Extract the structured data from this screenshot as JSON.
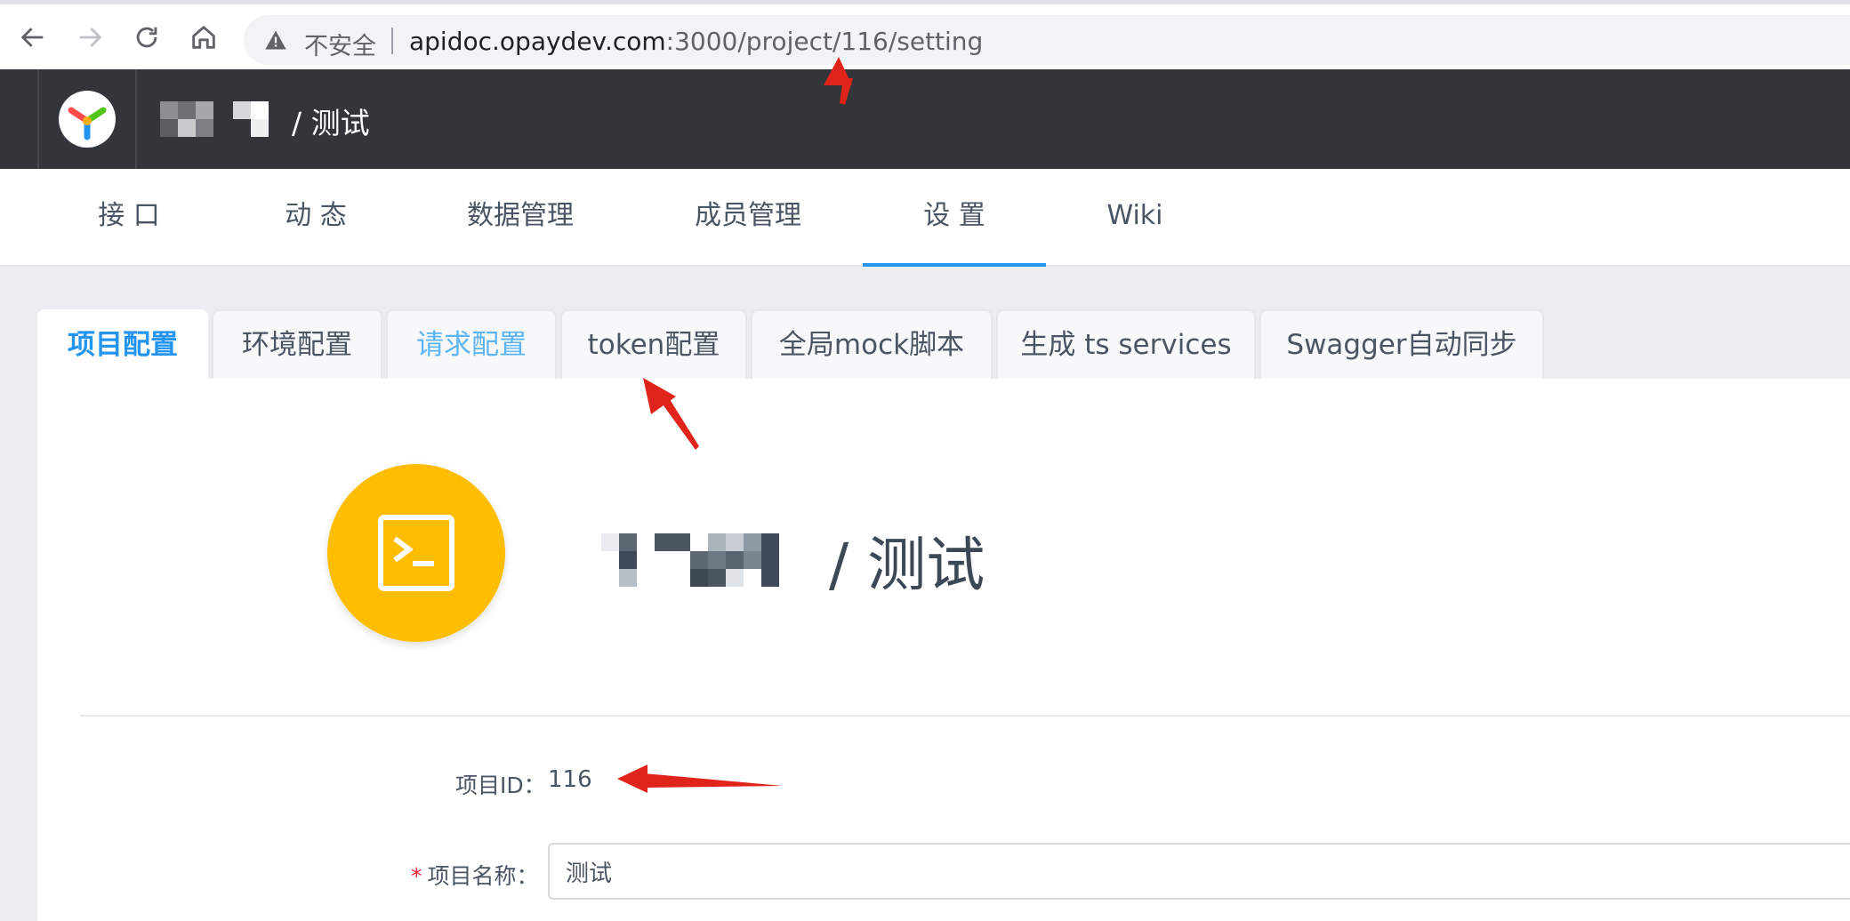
{
  "browser": {
    "url_insecure_label": "不安全",
    "url_host": "apidoc.opaydev.com",
    "url_path": ":3000/project/116/setting",
    "icons": [
      "back-arrow-icon",
      "forward-arrow-icon",
      "reload-icon",
      "home-icon",
      "warning-triangle-icon"
    ]
  },
  "header": {
    "breadcrumb_separator": "/",
    "project_name": "测试",
    "logo": "yapi-logo-icon"
  },
  "main_nav": {
    "tabs": [
      {
        "label": "接 口"
      },
      {
        "label": "动 态"
      },
      {
        "label": "数据管理"
      },
      {
        "label": "成员管理"
      },
      {
        "label": "设 置",
        "active": true
      },
      {
        "label": "Wiki"
      }
    ]
  },
  "settings_tabs": [
    {
      "label": "项目配置",
      "active": true
    },
    {
      "label": "环境配置"
    },
    {
      "label": "请求配置",
      "hover": true
    },
    {
      "label": "token配置"
    },
    {
      "label": "全局mock脚本"
    },
    {
      "label": "生成 ts services"
    },
    {
      "label": "Swagger自动同步"
    }
  ],
  "project": {
    "avatar_icon": "terminal-icon",
    "avatar_color": "#ffbd00",
    "title_separator": "/",
    "title_name": "测试",
    "id_label": "项目ID：",
    "id_value": "116",
    "name_label": "项目名称：",
    "name_required_mark": "*",
    "name_value": "测试"
  },
  "colors": {
    "accent": "#2395f1",
    "header_bg": "#32363b",
    "annotation_arrow": "#e0231b"
  }
}
